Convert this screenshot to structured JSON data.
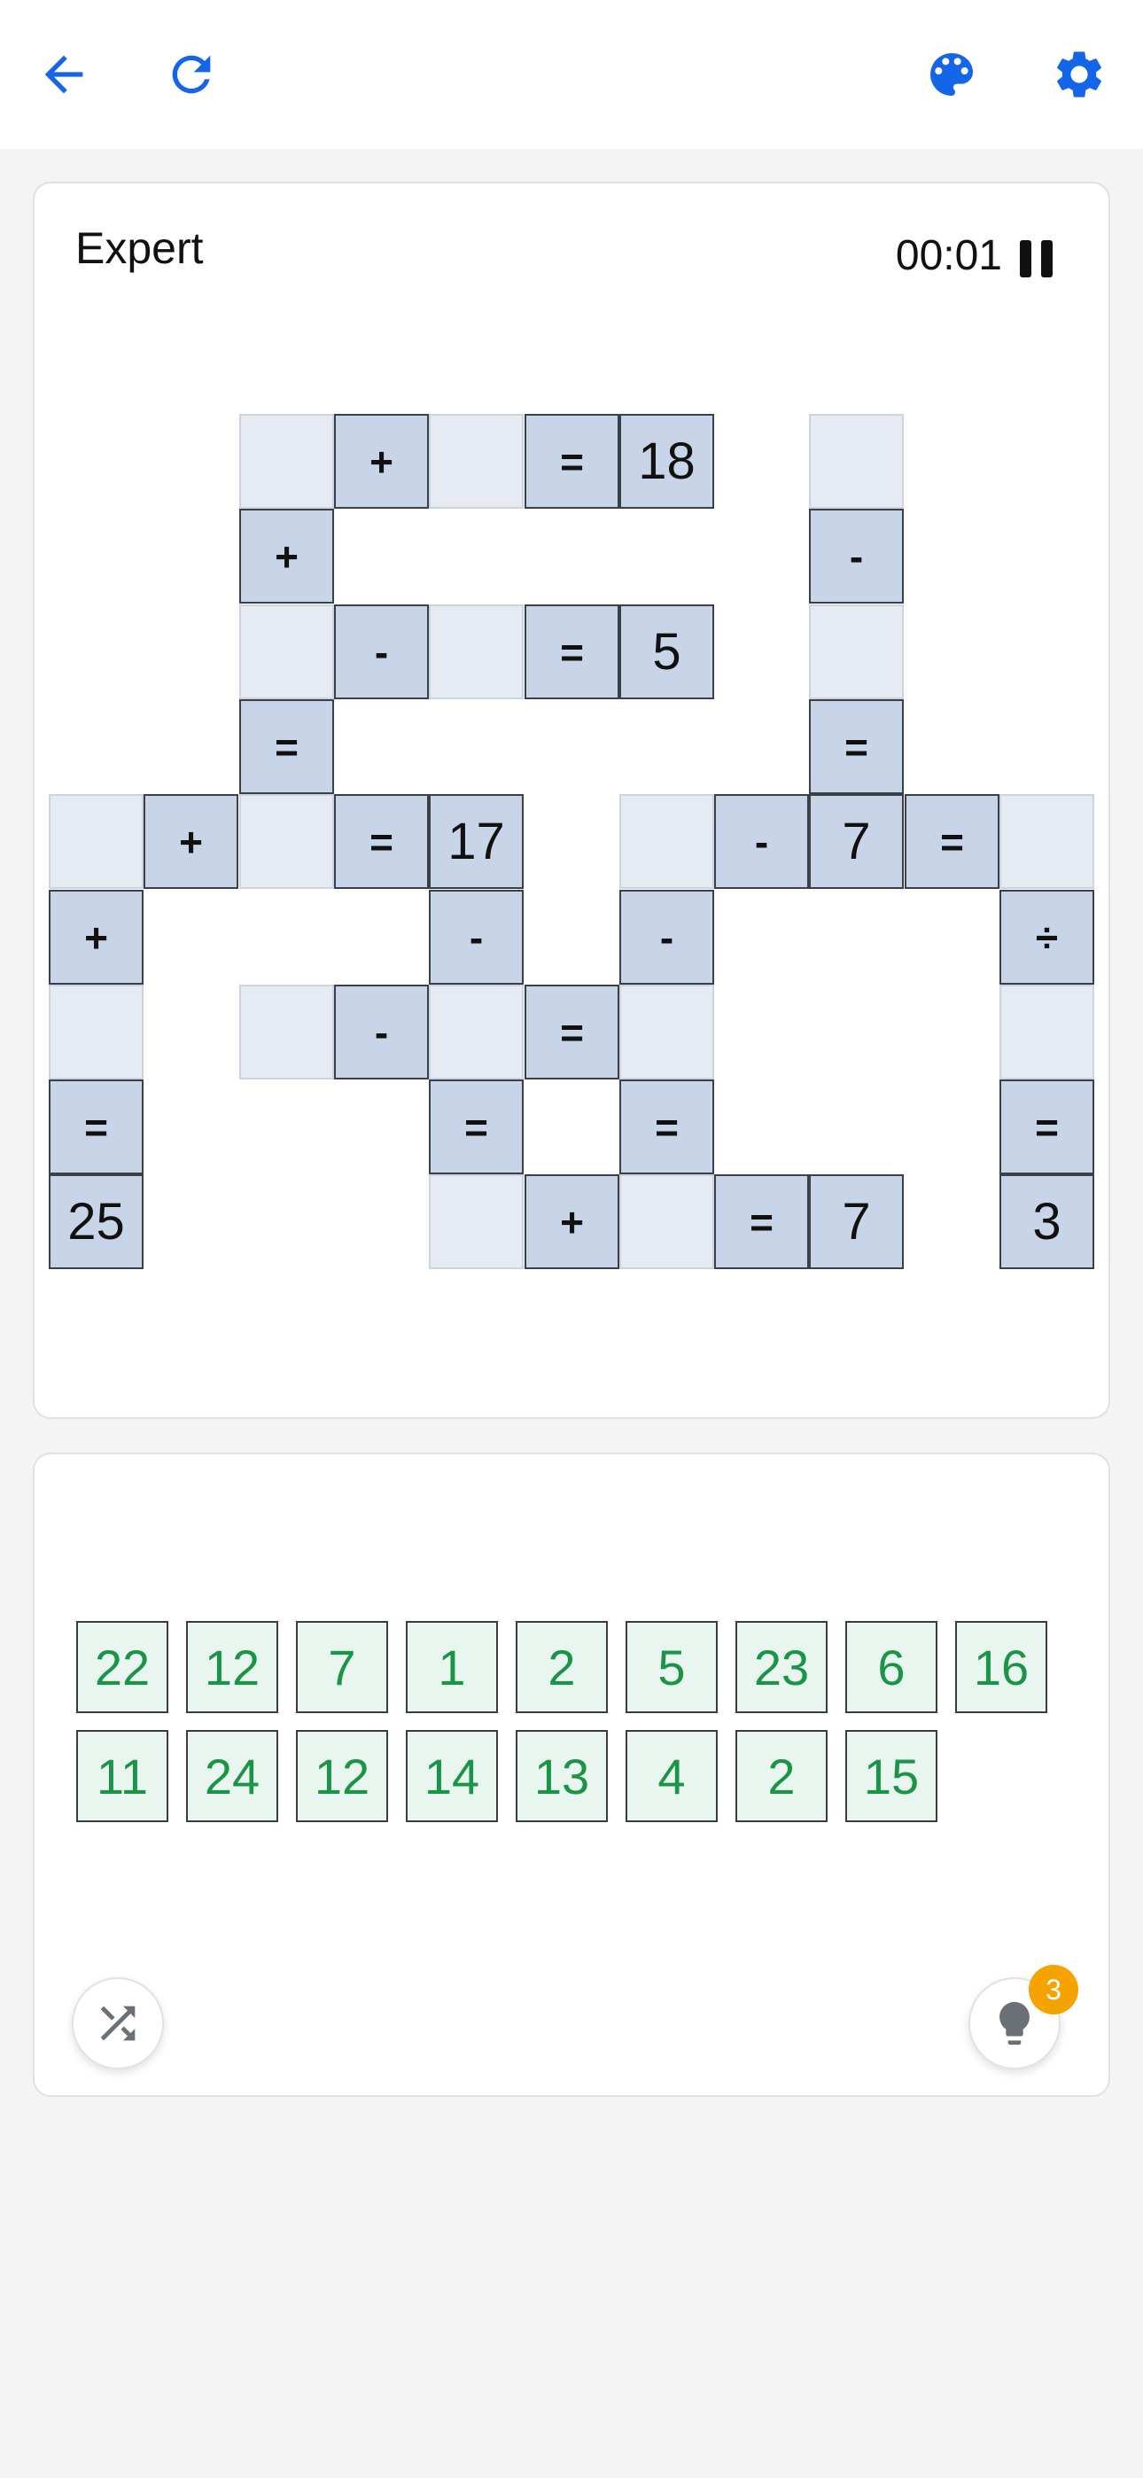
{
  "header": {
    "icons": [
      "back-arrow-icon",
      "refresh-icon",
      "palette-icon",
      "settings-icon"
    ],
    "accent_color": "#1565e8"
  },
  "board": {
    "level": "Expert",
    "timer": "00:01",
    "cells": [
      {
        "r": 0,
        "c": 2,
        "v": "",
        "t": "empty"
      },
      {
        "r": 0,
        "c": 3,
        "v": "+",
        "t": "op"
      },
      {
        "r": 0,
        "c": 4,
        "v": "",
        "t": "empty"
      },
      {
        "r": 0,
        "c": 5,
        "v": "=",
        "t": "op"
      },
      {
        "r": 0,
        "c": 6,
        "v": "18",
        "t": "num"
      },
      {
        "r": 0,
        "c": 8,
        "v": "",
        "t": "empty"
      },
      {
        "r": 1,
        "c": 2,
        "v": "+",
        "t": "op"
      },
      {
        "r": 1,
        "c": 8,
        "v": "-",
        "t": "op"
      },
      {
        "r": 2,
        "c": 2,
        "v": "",
        "t": "empty"
      },
      {
        "r": 2,
        "c": 3,
        "v": "-",
        "t": "op"
      },
      {
        "r": 2,
        "c": 4,
        "v": "",
        "t": "empty"
      },
      {
        "r": 2,
        "c": 5,
        "v": "=",
        "t": "op"
      },
      {
        "r": 2,
        "c": 6,
        "v": "5",
        "t": "num"
      },
      {
        "r": 2,
        "c": 8,
        "v": "",
        "t": "empty"
      },
      {
        "r": 3,
        "c": 2,
        "v": "=",
        "t": "op"
      },
      {
        "r": 3,
        "c": 8,
        "v": "=",
        "t": "op"
      },
      {
        "r": 4,
        "c": 0,
        "v": "",
        "t": "empty"
      },
      {
        "r": 4,
        "c": 1,
        "v": "+",
        "t": "op"
      },
      {
        "r": 4,
        "c": 2,
        "v": "",
        "t": "empty"
      },
      {
        "r": 4,
        "c": 3,
        "v": "=",
        "t": "op"
      },
      {
        "r": 4,
        "c": 4,
        "v": "17",
        "t": "num"
      },
      {
        "r": 4,
        "c": 6,
        "v": "",
        "t": "empty"
      },
      {
        "r": 4,
        "c": 7,
        "v": "-",
        "t": "op"
      },
      {
        "r": 4,
        "c": 8,
        "v": "7",
        "t": "num"
      },
      {
        "r": 4,
        "c": 9,
        "v": "=",
        "t": "op"
      },
      {
        "r": 4,
        "c": 10,
        "v": "",
        "t": "empty"
      },
      {
        "r": 5,
        "c": 0,
        "v": "+",
        "t": "op"
      },
      {
        "r": 5,
        "c": 4,
        "v": "-",
        "t": "op"
      },
      {
        "r": 5,
        "c": 6,
        "v": "-",
        "t": "op"
      },
      {
        "r": 5,
        "c": 10,
        "v": "÷",
        "t": "op"
      },
      {
        "r": 6,
        "c": 0,
        "v": "",
        "t": "empty"
      },
      {
        "r": 6,
        "c": 2,
        "v": "",
        "t": "empty"
      },
      {
        "r": 6,
        "c": 3,
        "v": "-",
        "t": "op"
      },
      {
        "r": 6,
        "c": 4,
        "v": "",
        "t": "empty"
      },
      {
        "r": 6,
        "c": 5,
        "v": "=",
        "t": "op"
      },
      {
        "r": 6,
        "c": 6,
        "v": "",
        "t": "empty"
      },
      {
        "r": 6,
        "c": 10,
        "v": "",
        "t": "empty"
      },
      {
        "r": 7,
        "c": 0,
        "v": "=",
        "t": "op"
      },
      {
        "r": 7,
        "c": 4,
        "v": "=",
        "t": "op"
      },
      {
        "r": 7,
        "c": 6,
        "v": "=",
        "t": "op"
      },
      {
        "r": 7,
        "c": 10,
        "v": "=",
        "t": "op"
      },
      {
        "r": 8,
        "c": 0,
        "v": "25",
        "t": "num"
      },
      {
        "r": 8,
        "c": 4,
        "v": "",
        "t": "empty"
      },
      {
        "r": 8,
        "c": 5,
        "v": "+",
        "t": "op"
      },
      {
        "r": 8,
        "c": 6,
        "v": "",
        "t": "empty"
      },
      {
        "r": 8,
        "c": 7,
        "v": "=",
        "t": "op"
      },
      {
        "r": 8,
        "c": 8,
        "v": "7",
        "t": "num"
      },
      {
        "r": 8,
        "c": 10,
        "v": "3",
        "t": "num"
      }
    ]
  },
  "tray": {
    "rows": [
      [
        "22",
        "12",
        "7",
        "1",
        "2",
        "5",
        "23",
        "6",
        "16"
      ],
      [
        "11",
        "24",
        "12",
        "14",
        "13",
        "4",
        "2",
        "15"
      ]
    ],
    "shuffle_icon": "shuffle-icon",
    "hint_icon": "lightbulb-icon",
    "hint_count": "3"
  }
}
